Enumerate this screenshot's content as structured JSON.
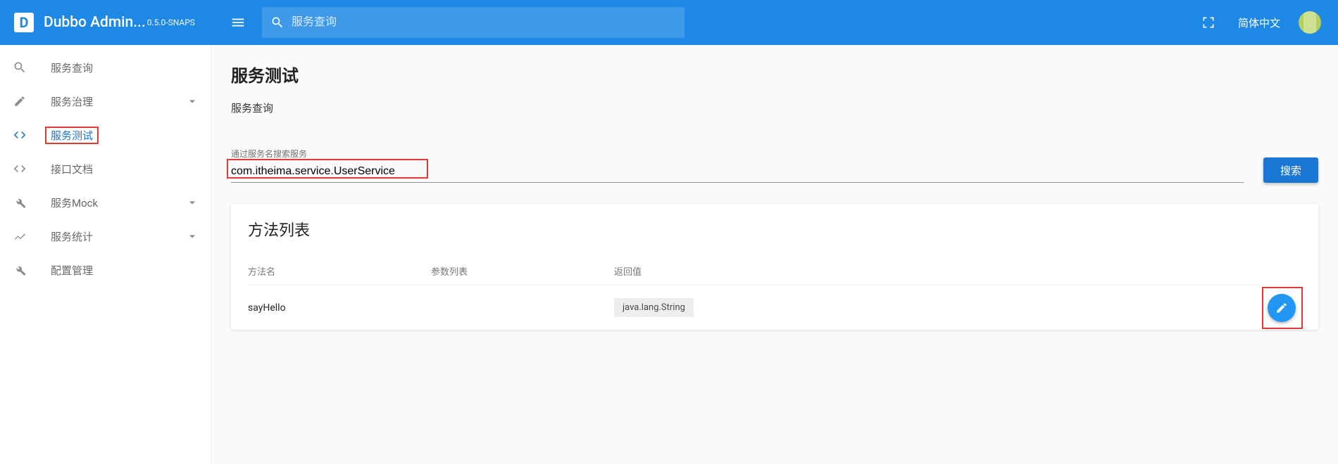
{
  "header": {
    "app_name": "Dubbo Admin...",
    "version": "0.5.0-SNAPS",
    "search_placeholder": "服务查询",
    "language_label": "简体中文"
  },
  "sidebar": {
    "items": [
      {
        "label": "服务查询",
        "icon": "search"
      },
      {
        "label": "服务治理",
        "icon": "pencil",
        "expandable": true
      },
      {
        "label": "服务测试",
        "icon": "code",
        "active": true
      },
      {
        "label": "接口文档",
        "icon": "code"
      },
      {
        "label": "服务Mock",
        "icon": "wrench",
        "expandable": true
      },
      {
        "label": "服务统计",
        "icon": "trend",
        "expandable": true
      },
      {
        "label": "配置管理",
        "icon": "wrench"
      }
    ]
  },
  "page": {
    "title": "服务测试",
    "breadcrumb": "服务查询",
    "search_field_label": "通过服务名搜索服务",
    "search_value": "com.itheima.service.UserService",
    "search_button": "搜索"
  },
  "method_table": {
    "title": "方法列表",
    "columns": {
      "name": "方法名",
      "params": "参数列表",
      "return": "返回值"
    },
    "rows": [
      {
        "name": "sayHello",
        "param": "java.lang.String",
        "return": ""
      }
    ]
  }
}
